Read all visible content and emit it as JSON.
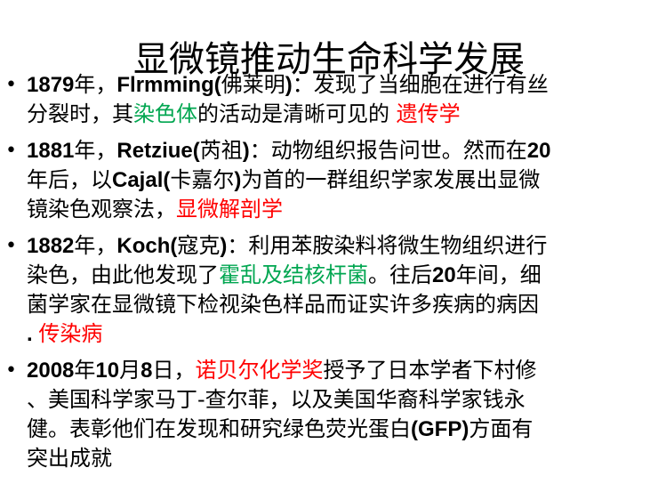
{
  "title": "显微镜推动生命科学发展",
  "colors": {
    "red": "#ff0000",
    "green": "#00a650",
    "text": "#000000"
  },
  "bullets": [
    {
      "lines": [
        [
          {
            "text": "1879",
            "style": "num"
          },
          {
            "text": "年，"
          },
          {
            "text": "Flrmming(",
            "style": "num"
          },
          {
            "text": "佛莱明"
          },
          {
            "text": ")",
            "style": "num"
          },
          {
            "text": "：发现了当细胞在进行有丝"
          }
        ],
        [
          {
            "text": "分裂时，其"
          },
          {
            "text": "染色体",
            "style": "hl-green"
          },
          {
            "text": "的活动是清晰可见的 "
          },
          {
            "text": "遗传学",
            "style": "hl-red"
          }
        ]
      ]
    },
    {
      "lines": [
        [
          {
            "text": "1881",
            "style": "num"
          },
          {
            "text": "年，"
          },
          {
            "text": "Retziue(",
            "style": "num"
          },
          {
            "text": "芮祖"
          },
          {
            "text": ")",
            "style": "num"
          },
          {
            "text": "：动物组织报告问世。然而在"
          },
          {
            "text": "20",
            "style": "num"
          }
        ],
        [
          {
            "text": "年后，以"
          },
          {
            "text": "Cajal(",
            "style": "num"
          },
          {
            "text": "卡嘉尔"
          },
          {
            "text": ")",
            "style": "num"
          },
          {
            "text": "为首的一群组织学家发展出显微"
          }
        ],
        [
          {
            "text": "镜染色观察法，"
          },
          {
            "text": "显微解剖学",
            "style": "hl-red"
          }
        ]
      ]
    },
    {
      "lines": [
        [
          {
            "text": "1882",
            "style": "num"
          },
          {
            "text": "年，"
          },
          {
            "text": "Koch(",
            "style": "num"
          },
          {
            "text": "寇克"
          },
          {
            "text": ")",
            "style": "num"
          },
          {
            "text": "：利用苯胺染料将微生物组织进行"
          }
        ],
        [
          {
            "text": "染色，由此他发现了"
          },
          {
            "text": "霍乱及结核杆菌",
            "style": "hl-green"
          },
          {
            "text": "。往后"
          },
          {
            "text": "20",
            "style": "num"
          },
          {
            "text": "年间，细"
          }
        ],
        [
          {
            "text": "菌学家在显微镜下检视染色样品而证实许多疾病的病因"
          }
        ],
        [
          {
            "text": ". ",
            "style": "num"
          },
          {
            "text": "传染病",
            "style": "hl-red"
          }
        ]
      ]
    },
    {
      "lines": [
        [
          {
            "text": "2008",
            "style": "num"
          },
          {
            "text": "年"
          },
          {
            "text": "10",
            "style": "num"
          },
          {
            "text": "月"
          },
          {
            "text": "8",
            "style": "num"
          },
          {
            "text": "日，"
          },
          {
            "text": "诺贝尔化学奖",
            "style": "hl-red"
          },
          {
            "text": "授予了日本学者下村修"
          }
        ],
        [
          {
            "text": "、美国科学家马丁-查尔菲，以及美国华裔科学家钱永"
          }
        ],
        [
          {
            "text": "健。表彰他们在发现和研究绿色荧光蛋白"
          },
          {
            "text": "(GFP)",
            "style": "num"
          },
          {
            "text": "方面有"
          }
        ],
        [
          {
            "text": "突出成就"
          }
        ]
      ]
    }
  ]
}
